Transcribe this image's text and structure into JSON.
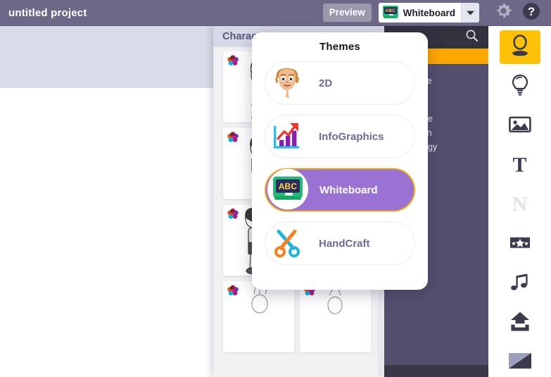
{
  "topbar": {
    "project_title": "untitled project",
    "preview_label": "Preview",
    "theme_selected": "Whiteboard",
    "theme_icon": "abc-chalkboard-icon",
    "dropdown_arrow_icon": "chevron-down-icon",
    "gear_icon": "gear-icon",
    "help_icon": "help-icon",
    "bar_color": "#6e6888",
    "preview_btn_color": "#9b98ae"
  },
  "characters_panel": {
    "title": "Characters",
    "collapse_icon": "double-chevron-right-icon",
    "badge_icon": "flower-palette-icon",
    "header_color": "#d5d8e6",
    "title_color": "#5c567c",
    "thumbs": [
      {
        "name": "character-thumb-1",
        "alt": "sketch character"
      },
      {
        "name": "character-thumb-2",
        "alt": "sketch easel"
      },
      {
        "name": "character-thumb-3",
        "alt": "sketch woman standing"
      },
      {
        "name": "character-thumb-4",
        "alt": "sketch woman with phone"
      },
      {
        "name": "character-thumb-5",
        "alt": "sketch woman pointing"
      },
      {
        "name": "character-thumb-6",
        "alt": "sketch woman on hoverboard"
      },
      {
        "name": "character-thumb-7",
        "alt": "sketch woman at computer"
      },
      {
        "name": "character-thumb-8",
        "alt": "sketch character partial"
      },
      {
        "name": "character-thumb-9",
        "alt": "sketch character partial"
      }
    ]
  },
  "library_panel": {
    "search_icon": "search-icon",
    "highlight_color": "#ffa700",
    "categories": [
      "Corporate",
      "Fashion",
      "Adventure",
      "Education",
      "Technology"
    ]
  },
  "themes_popup": {
    "title": "Themes",
    "selected": "Whiteboard",
    "selected_bg": "#9a72d4",
    "selected_border": "#f0a821",
    "label_color": "#6f6a90",
    "items": [
      {
        "label": "2D",
        "icon": "cartoon-face-icon",
        "selected": false
      },
      {
        "label": "InfoGraphics",
        "icon": "bar-chart-arrow-icon",
        "selected": false
      },
      {
        "label": "Whiteboard",
        "icon": "abc-chalkboard-icon",
        "selected": true
      },
      {
        "label": "HandCraft",
        "icon": "scissors-icon",
        "selected": false
      }
    ]
  },
  "right_rail": {
    "active_color": "#ffc107",
    "items": [
      {
        "name": "characters",
        "icon": "character-icon",
        "glyph": "",
        "active": true,
        "disabled": false
      },
      {
        "name": "props",
        "icon": "lightbulb-icon",
        "glyph": "",
        "active": false,
        "disabled": false
      },
      {
        "name": "images",
        "icon": "image-icon",
        "glyph": "",
        "active": false,
        "disabled": false
      },
      {
        "name": "text",
        "icon": "text-tool-icon",
        "glyph": "T",
        "active": false,
        "disabled": false
      },
      {
        "name": "numbers",
        "icon": "number-tool-icon",
        "glyph": "N",
        "active": false,
        "disabled": true
      },
      {
        "name": "effects",
        "icon": "stars-effect-icon",
        "glyph": "",
        "active": false,
        "disabled": false
      },
      {
        "name": "audio",
        "icon": "music-note-icon",
        "glyph": "",
        "active": false,
        "disabled": false
      },
      {
        "name": "upload",
        "icon": "upload-icon",
        "glyph": "",
        "active": false,
        "disabled": false
      },
      {
        "name": "background",
        "icon": "background-swatch-icon",
        "glyph": "",
        "active": false,
        "disabled": false
      }
    ]
  }
}
